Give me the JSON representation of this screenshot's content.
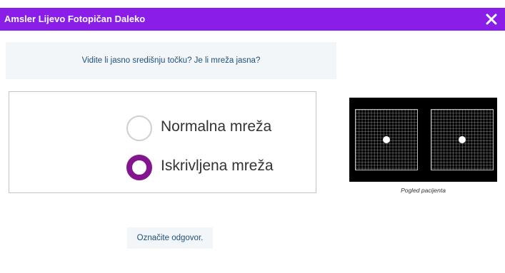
{
  "window": {
    "title": "Amsler Lijevo Fotopičan Daleko",
    "close_icon": "close-icon"
  },
  "question": {
    "text": "Vidite li jasno središnju točku? Je li mreža jasna?"
  },
  "options": [
    {
      "label": "Normalna mreža",
      "selected": false
    },
    {
      "label": "Iskrivljena mreža",
      "selected": true
    }
  ],
  "preview": {
    "caption": "Pogled pacijenta"
  },
  "hint": {
    "text": "Označite odgovor."
  },
  "colors": {
    "titlebar": "#8a1ee8",
    "radio_selected": "#85148f",
    "question_text": "#1d4f7c",
    "panel_background": "#f2f6f8"
  }
}
